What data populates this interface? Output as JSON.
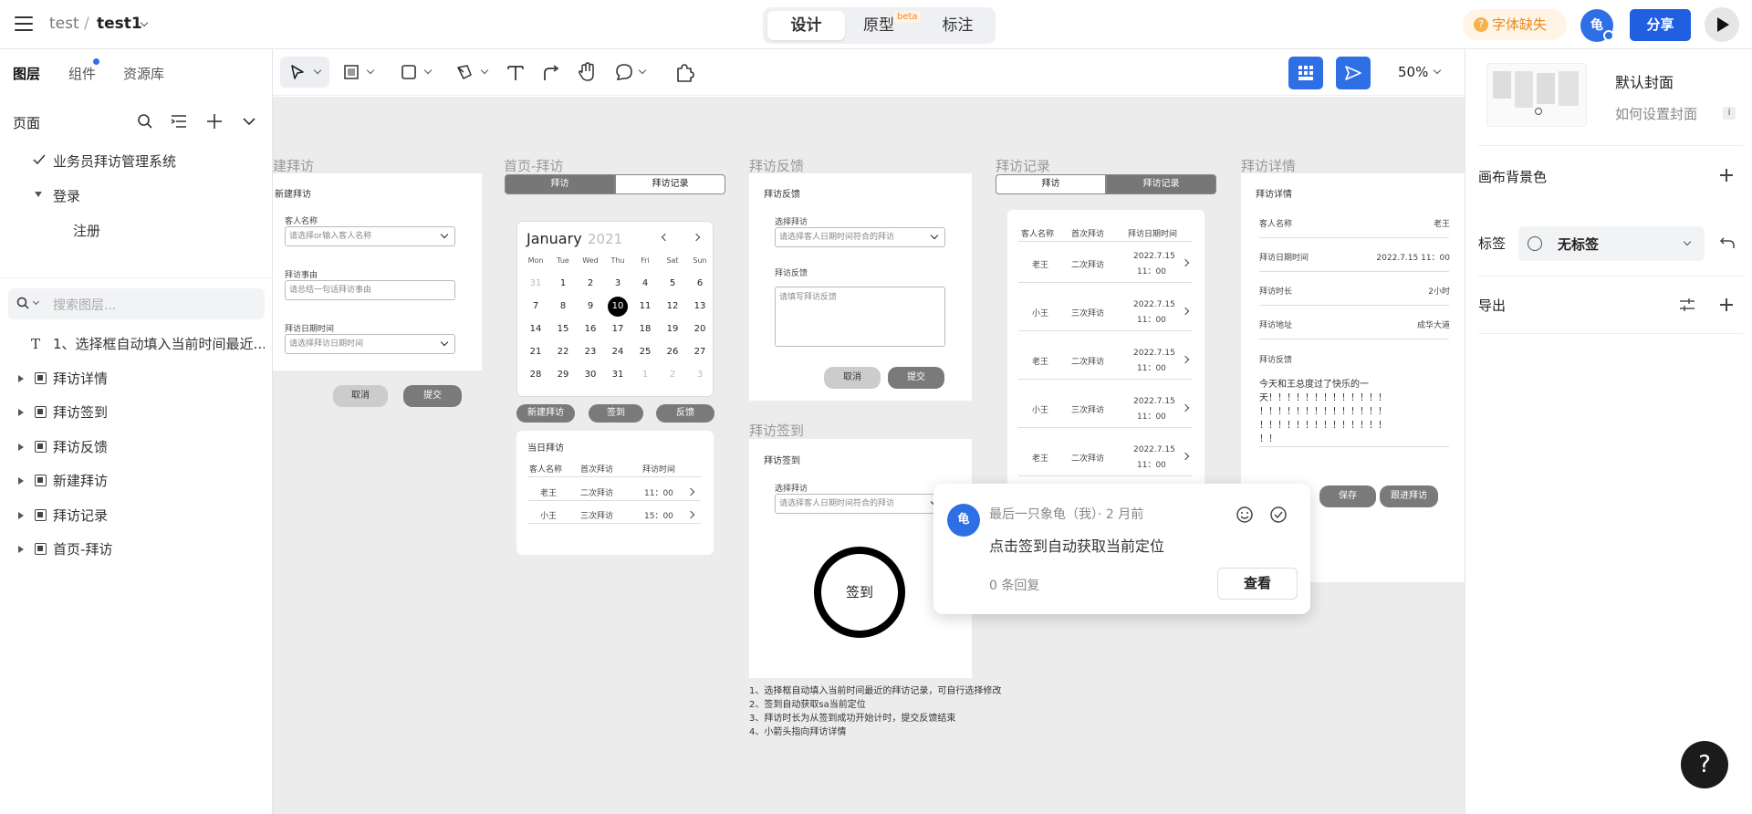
{
  "header": {
    "project": "test",
    "separator": "/",
    "file": "test1",
    "modes": [
      "设计",
      "原型",
      "标注"
    ],
    "beta": "beta",
    "font_missing": "字体缺失",
    "avatar": "龟",
    "share": "分享"
  },
  "left": {
    "tabs": [
      "图层",
      "组件",
      "资源库"
    ],
    "pages_title": "页面",
    "pages": [
      "业务员拜访管理系统",
      "登录",
      "注册"
    ],
    "search_placeholder": "搜索图层...",
    "layers": [
      "1、选择框自动填入当前时间最近...",
      "拜访详情",
      "拜访签到",
      "拜访反馈",
      "新建拜访",
      "拜访记录",
      "首页-拜访"
    ]
  },
  "toolbar": {
    "zoom": "50%"
  },
  "canvas": {
    "b1": {
      "title": "建拜访",
      "heading": "新建拜访",
      "l1": "客人名称",
      "p1": "请选择or输入客人名称",
      "l2": "拜访事由",
      "p2": "请总结一句话拜访事由",
      "l3": "拜访日期时间",
      "p3": "请选择拜访日期时间",
      "cancel": "取消",
      "submit": "提交"
    },
    "b2": {
      "title": "首页-拜访",
      "tab1": "拜访",
      "tab2": "拜访记录",
      "month": "January",
      "year": "2021",
      "weekdays": [
        "Mon",
        "Tue",
        "Wed",
        "Thu",
        "Fri",
        "Sat",
        "Sun"
      ],
      "weeks": [
        [
          "31",
          "1",
          "2",
          "3",
          "4",
          "5",
          "6"
        ],
        [
          "7",
          "8",
          "9",
          "10",
          "11",
          "12",
          "13"
        ],
        [
          "14",
          "15",
          "16",
          "17",
          "18",
          "19",
          "20"
        ],
        [
          "21",
          "22",
          "23",
          "24",
          "25",
          "26",
          "27"
        ],
        [
          "28",
          "29",
          "30",
          "31",
          "1",
          "2",
          "3"
        ]
      ],
      "btn1": "新建拜访",
      "btn2": "签到",
      "btn3": "反馈",
      "today": "当日拜访",
      "h1": "客人名称",
      "h2": "首次拜访",
      "h3": "拜访时间",
      "rows": [
        [
          "老王",
          "二次拜访",
          "11：00"
        ],
        [
          "小王",
          "三次拜访",
          "15：00"
        ]
      ]
    },
    "b3": {
      "title": "拜访反馈",
      "heading": "拜访反馈",
      "l1": "选择拜访",
      "p1": "请选择客人日期时间符合的拜访",
      "l2": "拜访反馈",
      "p2": "请填写拜访反馈",
      "cancel": "取消",
      "submit": "提交"
    },
    "b4": {
      "title": "拜访签到",
      "heading": "拜访签到",
      "l1": "选择拜访",
      "p1": "请选择客人日期时间符合的拜访",
      "sign": "签到"
    },
    "b5": {
      "title": "拜访记录",
      "tab1": "拜访",
      "tab2": "拜访记录",
      "h1": "客人名称",
      "h2": "首次拜访",
      "h3": "拜访日期时间",
      "rows": [
        [
          "老王",
          "二次拜访",
          "2022.7.15",
          "11：00"
        ],
        [
          "小王",
          "三次拜访",
          "2022.7.15",
          "11：00"
        ],
        [
          "老王",
          "二次拜访",
          "2022.7.15",
          "11：00"
        ],
        [
          "小王",
          "三次拜访",
          "2022.7.15",
          "11：00"
        ],
        [
          "老王",
          "二次拜访",
          "2022.7.15",
          "11：00"
        ]
      ]
    },
    "b6": {
      "title": "拜访详情",
      "heading": "拜访详情",
      "fields": [
        [
          "客人名称",
          "老王"
        ],
        [
          "拜访日期时间",
          "2022.7.15 11：00"
        ],
        [
          "拜访时长",
          "2小时"
        ],
        [
          "拜访地址",
          "成华大道"
        ]
      ],
      "fb_label": "拜访反馈",
      "fb_text": [
        "今天和王总度过了快乐的一",
        "天！！！！！！！！！！！！！",
        "！！！！！！！！！！！！！！",
        "！！！！！！！！！！！！！！",
        "！！"
      ],
      "save": "保存",
      "follow": "跟进拜访"
    },
    "notes": [
      "1、选择框自动填入当前时间最近的拜访记录，可自行选择修改",
      "2、签到自动获取sa当前定位",
      "3、拜访时长为从签到成功开始计时，提交反馈结束",
      "4、小箭头指向拜访详情"
    ]
  },
  "comment": {
    "avatar": "龟",
    "author": "最后一只象龟（我）· 2 月前",
    "text": "点击签到自动获取当前定位",
    "replies": "0 条回复",
    "view": "查看"
  },
  "right": {
    "cover_title": "默认封面",
    "cover_help": "如何设置封面",
    "bg": "画布背景色",
    "tag_label": "标签",
    "tag_value": "无标签",
    "export": "导出"
  },
  "help": "?"
}
